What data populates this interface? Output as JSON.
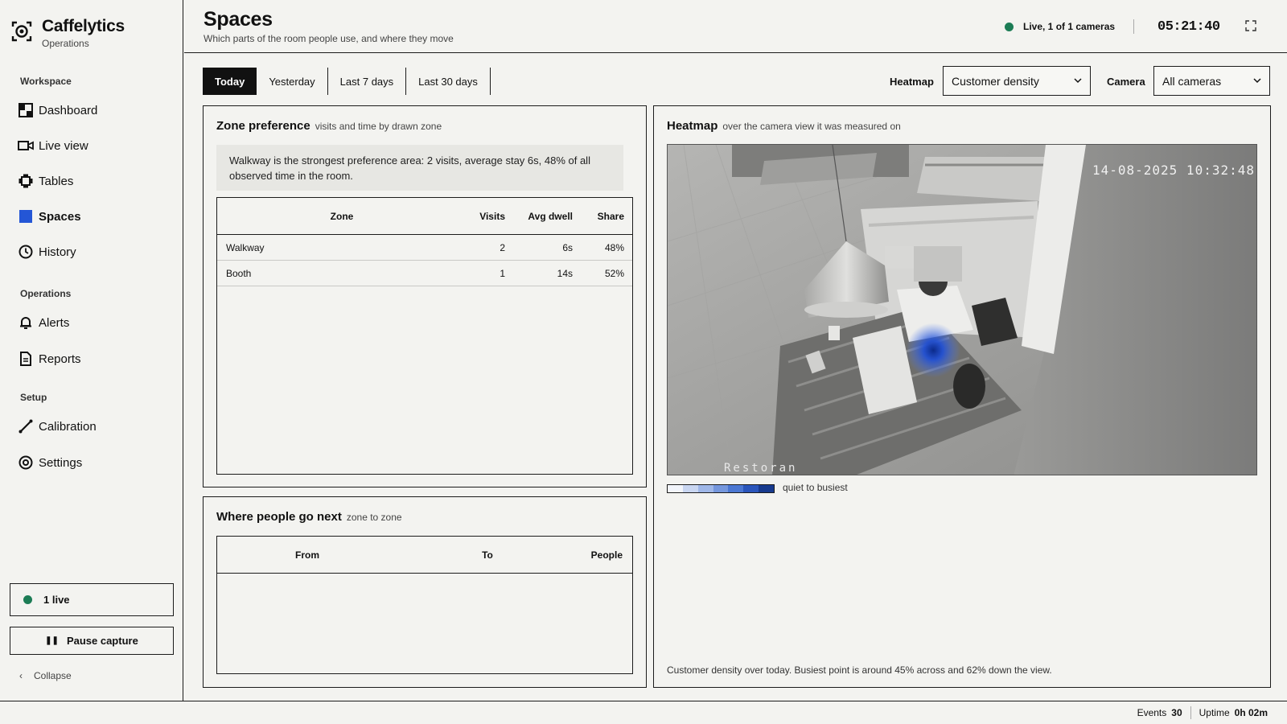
{
  "brand": {
    "title": "Caffelytics",
    "subtitle": "Operations"
  },
  "sidebar": {
    "sections": [
      "Workspace",
      "Operations",
      "Setup"
    ],
    "items": [
      {
        "label": "Dashboard",
        "icon": "dashboard-icon"
      },
      {
        "label": "Live view",
        "icon": "video-icon"
      },
      {
        "label": "Tables",
        "icon": "table-icon"
      },
      {
        "label": "Spaces",
        "icon": "square-icon",
        "active": true
      },
      {
        "label": "History",
        "icon": "clock-icon"
      },
      {
        "label": "Alerts",
        "icon": "bell-icon"
      },
      {
        "label": "Reports",
        "icon": "document-icon"
      },
      {
        "label": "Calibration",
        "icon": "ruler-icon"
      },
      {
        "label": "Settings",
        "icon": "gear-icon"
      }
    ],
    "live_label": "1 live",
    "pause_label": "Pause capture",
    "collapse_label": "Collapse"
  },
  "header": {
    "title": "Spaces",
    "subtitle": "Which parts of the room people use, and where they move",
    "live_status": "Live, 1 of 1 cameras",
    "clock": "05:21:40"
  },
  "toolbar": {
    "tabs": [
      "Today",
      "Yesterday",
      "Last 7 days",
      "Last 30 days"
    ],
    "active_tab": "Today",
    "heatmap_label": "Heatmap",
    "heatmap_value": "Customer density",
    "camera_label": "Camera",
    "camera_value": "All cameras"
  },
  "zone_preference": {
    "title": "Zone preference",
    "subtitle": "visits and time by drawn zone",
    "insight": "Walkway is the strongest preference area: 2 visits, average stay 6s, 48% of all observed time in the room.",
    "columns": [
      "Zone",
      "Visits",
      "Avg dwell",
      "Share"
    ],
    "rows": [
      {
        "zone": "Walkway",
        "visits": "2",
        "dwell": "6s",
        "share": "48%"
      },
      {
        "zone": "Booth",
        "visits": "1",
        "dwell": "14s",
        "share": "52%"
      }
    ]
  },
  "flows": {
    "title": "Where people go next",
    "subtitle": "zone to zone",
    "columns": [
      "From",
      "To",
      "People"
    ]
  },
  "heatmap": {
    "title": "Heatmap",
    "subtitle": "over the camera view it was measured on",
    "timestamp": "14-08-2025 10:32:48",
    "cam_label": "Restoran",
    "legend": "quiet to busiest",
    "legend_colors": [
      "#f2f5fb",
      "#c9d6f1",
      "#9fb7e8",
      "#7597dd",
      "#4b77d2",
      "#2a55bb",
      "#173a8e"
    ],
    "hotspot_color": "#1f4fd6",
    "hotspot_x_fraction": 0.45,
    "hotspot_y_fraction": 0.62,
    "caption": "Customer density over today. Busiest point is around 45% across and 62% down the view."
  },
  "footer": {
    "events_label": "Events",
    "events_value": "30",
    "uptime_label": "Uptime",
    "uptime_value": "0h 02m"
  },
  "colors": {
    "live": "#1c7c55",
    "accent": "#1f4fd6"
  }
}
